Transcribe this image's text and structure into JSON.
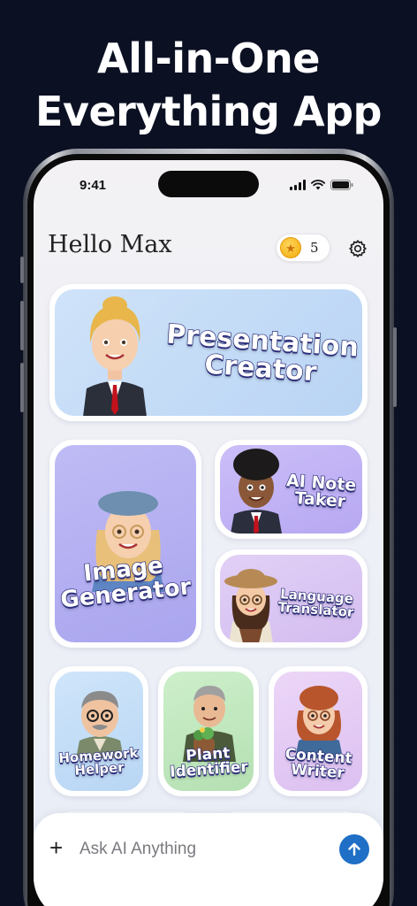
{
  "promo": {
    "headline_line1": "All-in-One",
    "headline_line2": "Everything App"
  },
  "status_bar": {
    "time": "9:41"
  },
  "header": {
    "greeting": "Hello Max",
    "coins": "5"
  },
  "tiles": {
    "presentation": {
      "line1": "Presentation",
      "line2": "Creator"
    },
    "image": {
      "line1": "Image",
      "line2": "Generator"
    },
    "note": {
      "line1": "AI Note",
      "line2": "Taker"
    },
    "language": {
      "line1": "Language",
      "line2": "Translator"
    },
    "homework": {
      "line1": "Homework",
      "line2": "Helper"
    },
    "plant": {
      "line1": "Plant",
      "line2": "Identifier"
    },
    "content": {
      "line1": "Content",
      "line2": "Writer"
    }
  },
  "chat": {
    "placeholder": "Ask AI Anything"
  },
  "colors": {
    "background": "#0b1023",
    "presentation_bg": "#c6ddf7",
    "image_bg": "#b7b3f2",
    "note_bg": "#c3b6f6",
    "language_bg": "#dcc9f3",
    "homework_bg": "#c5e0f8",
    "plant_bg": "#c8ecc6",
    "content_bg": "#e6cdf4",
    "send_button": "#1f6fc6",
    "label_outline": "#2d2f7d"
  },
  "icons": [
    "star-icon",
    "gear-icon",
    "plus-icon",
    "arrow-up-icon",
    "signal-icon",
    "wifi-icon",
    "battery-icon"
  ]
}
